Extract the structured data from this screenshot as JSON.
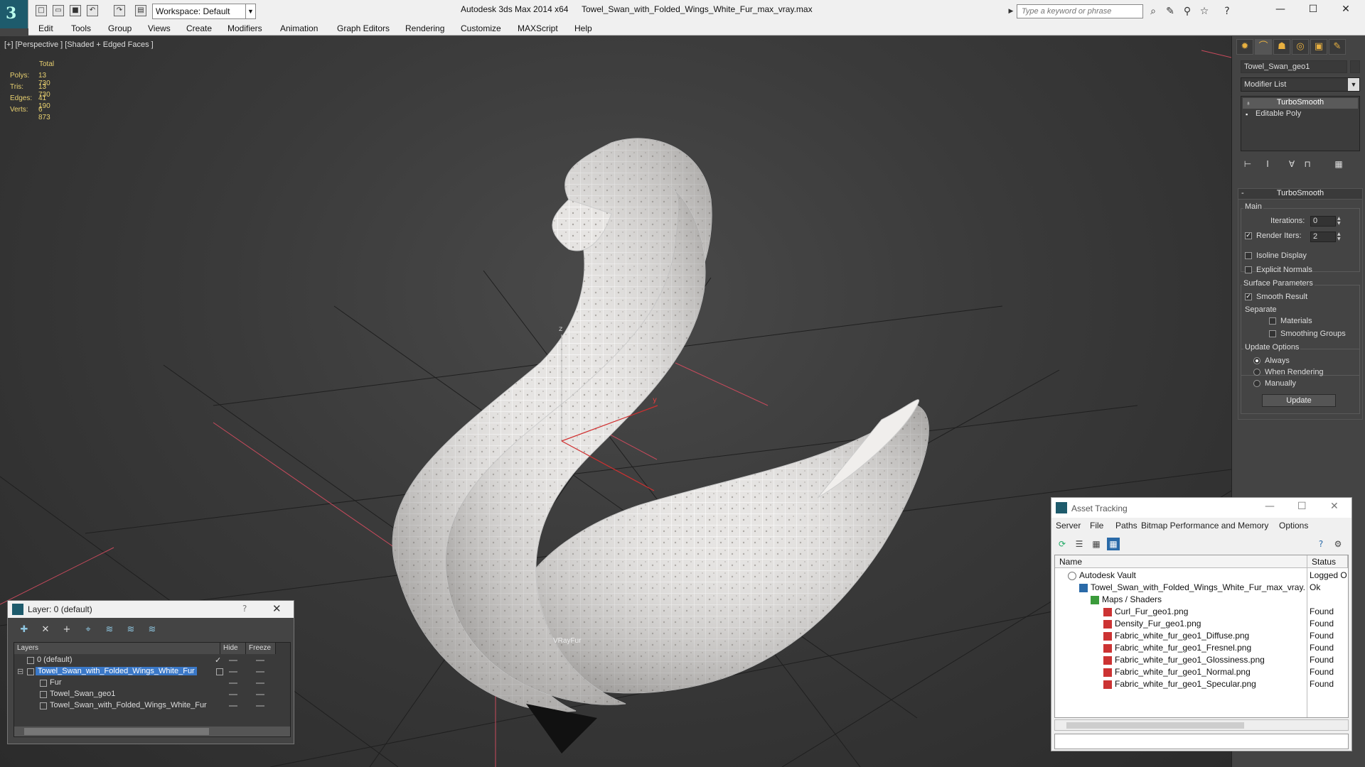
{
  "titlebar": {
    "workspace": "Workspace: Default",
    "app_title": "Autodesk 3ds Max  2014 x64",
    "doc_title": "Towel_Swan_with_Folded_Wings_White_Fur_max_vray.max",
    "search_placeholder": "Type a keyword or phrase"
  },
  "menu": [
    "Edit",
    "Tools",
    "Group",
    "Views",
    "Create",
    "Modifiers",
    "Animation",
    "Graph Editors",
    "Rendering",
    "Customize",
    "MAXScript",
    "Help"
  ],
  "viewport": {
    "label": "[+] [Perspective ] [Shaded + Edged Faces ]",
    "stats_header": "Total",
    "stats": [
      {
        "label": "Polys:",
        "value": "13 730"
      },
      {
        "label": "Tris:",
        "value": "13 730"
      },
      {
        "label": "Edges:",
        "value": "41 190"
      },
      {
        "label": "Verts:",
        "value": "6 873"
      }
    ],
    "vrayfur_label": "VRayFur",
    "axis_y": "y",
    "axis_z": "z"
  },
  "command_panel": {
    "object_name": "Towel_Swan_geo1",
    "modifier_list": "Modifier List",
    "stack": [
      "TurboSmooth",
      "Editable Poly"
    ],
    "turbosmooth": {
      "title": "TurboSmooth",
      "main_label": "Main",
      "iterations_label": "Iterations:",
      "iterations_value": "0",
      "render_iters_label": "Render Iters:",
      "render_iters_value": "2",
      "isoline": "Isoline Display",
      "explicit_normals": "Explicit Normals",
      "surface_params": "Surface Parameters",
      "smooth_result": "Smooth Result",
      "separate": "Separate",
      "materials": "Materials",
      "smoothing_groups": "Smoothing Groups",
      "update_options": "Update Options",
      "always": "Always",
      "when_rendering": "When Rendering",
      "manually": "Manually",
      "update_button": "Update"
    }
  },
  "layer_window": {
    "title": "Layer: 0 (default)",
    "help": "?",
    "col_layers": "Layers",
    "col_hide": "Hide",
    "col_freeze": "Freeze",
    "rows": [
      "0 (default)",
      "Towel_Swan_with_Folded_Wings_White_Fur",
      "Fur",
      "Towel_Swan_geo1",
      "Towel_Swan_with_Folded_Wings_White_Fur"
    ]
  },
  "asset_window": {
    "title": "Asset Tracking",
    "menu": [
      "Server",
      "File",
      "Paths",
      "Bitmap Performance and Memory",
      "Options"
    ],
    "col_name": "Name",
    "col_status": "Status",
    "rows": [
      {
        "name": "Autodesk Vault",
        "status": "Logged O"
      },
      {
        "name": "Towel_Swan_with_Folded_Wings_White_Fur_max_vray....",
        "status": "Ok"
      },
      {
        "name": "Maps / Shaders",
        "status": ""
      },
      {
        "name": "Curl_Fur_geo1.png",
        "status": "Found"
      },
      {
        "name": "Density_Fur_geo1.png",
        "status": "Found"
      },
      {
        "name": "Fabric_white_fur_geo1_Diffuse.png",
        "status": "Found"
      },
      {
        "name": "Fabric_white_fur_geo1_Fresnel.png",
        "status": "Found"
      },
      {
        "name": "Fabric_white_fur_geo1_Glossiness.png",
        "status": "Found"
      },
      {
        "name": "Fabric_white_fur_geo1_Normal.png",
        "status": "Found"
      },
      {
        "name": "Fabric_white_fur_geo1_Specular.png",
        "status": "Found"
      }
    ]
  }
}
